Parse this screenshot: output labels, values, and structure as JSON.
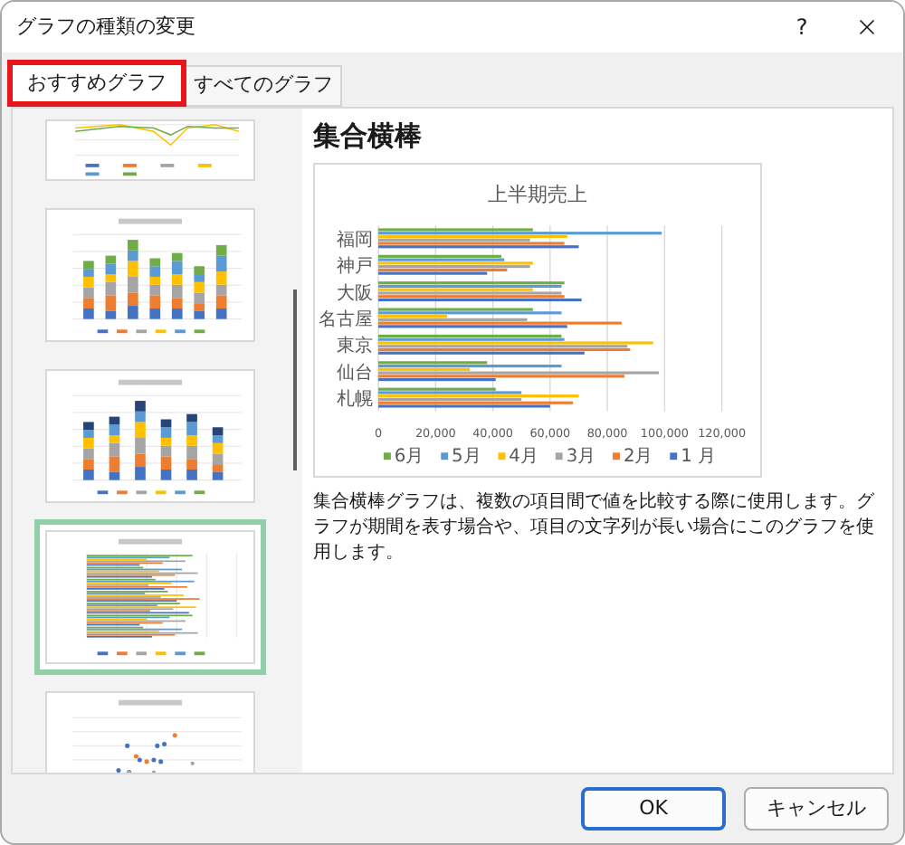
{
  "window": {
    "title": "グラフの種類の変更",
    "help": "?"
  },
  "tabs": [
    {
      "label": "おすすめグラフ",
      "selected": true
    },
    {
      "label": "すべてのグラフ",
      "selected": false
    }
  ],
  "thumbnails": [
    {
      "kind": "line",
      "selected": false
    },
    {
      "kind": "stacked-column",
      "selected": false
    },
    {
      "kind": "stacked-column",
      "selected": false
    },
    {
      "kind": "bar",
      "selected": true
    },
    {
      "kind": "scatter",
      "selected": false
    }
  ],
  "preview": {
    "heading": "集合横棒",
    "chart_data": {
      "type": "bar",
      "orientation": "horizontal",
      "title": "上半期売上",
      "categories": [
        "福岡",
        "神戸",
        "大阪",
        "名古屋",
        "東京",
        "仙台",
        "札幌"
      ],
      "series": [
        {
          "name": "1 月",
          "color": "#4472c4",
          "values": [
            70000,
            38000,
            71000,
            66000,
            72000,
            41000,
            60000
          ]
        },
        {
          "name": "2月",
          "color": "#ed7d31",
          "values": [
            65000,
            45000,
            65000,
            85000,
            88000,
            86000,
            68000
          ]
        },
        {
          "name": "3月",
          "color": "#a5a5a5",
          "values": [
            53000,
            53000,
            64000,
            52000,
            87000,
            98000,
            50000
          ]
        },
        {
          "name": "4月",
          "color": "#ffc000",
          "values": [
            66000,
            54000,
            54000,
            24000,
            96000,
            32000,
            70000
          ]
        },
        {
          "name": "5月",
          "color": "#5b9bd5",
          "values": [
            99000,
            44000,
            64000,
            64000,
            65000,
            64000,
            50000
          ]
        },
        {
          "name": "6月",
          "color": "#70ad47",
          "values": [
            54000,
            43000,
            65000,
            54000,
            64000,
            38000,
            41000
          ]
        }
      ],
      "grid": true,
      "legend": true,
      "xlim": [
        0,
        120000
      ],
      "xticks": [
        {
          "value": 0,
          "label": "0"
        },
        {
          "value": 20000,
          "label": "20,000"
        },
        {
          "value": 40000,
          "label": "40,000"
        },
        {
          "value": 60000,
          "label": "60,000"
        },
        {
          "value": 80000,
          "label": "80,000"
        },
        {
          "value": 100000,
          "label": "100,000"
        },
        {
          "value": 120000,
          "label": "120,000"
        }
      ]
    },
    "description": "集合横棒グラフは、複数の項目間で値を比較する際に使用します。グラフが期間を表す場合や、項目の文字列が長い場合にこのグラフを使用します。"
  },
  "buttons": [
    {
      "label": "OK",
      "default": true
    },
    {
      "label": "キャンセル",
      "default": false
    }
  ]
}
